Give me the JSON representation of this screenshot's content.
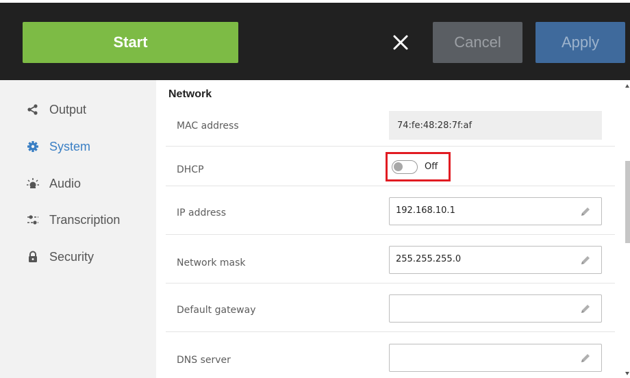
{
  "toolbar": {
    "start_label": "Start",
    "close_icon": "close-icon",
    "cancel_label": "Cancel",
    "apply_label": "Apply"
  },
  "sidebar": {
    "items": [
      {
        "label": "Output",
        "icon": "share-icon",
        "active": false
      },
      {
        "label": "System",
        "icon": "gear-icon",
        "active": true
      },
      {
        "label": "Audio",
        "icon": "audio-icon",
        "active": false
      },
      {
        "label": "Transcription",
        "icon": "sliders-icon",
        "active": false
      },
      {
        "label": "Security",
        "icon": "lock-icon",
        "active": false
      }
    ]
  },
  "network": {
    "title": "Network",
    "mac": {
      "label": "MAC address",
      "value": "74:fe:48:28:7f:af"
    },
    "dhcp": {
      "label": "DHCP",
      "state": "Off"
    },
    "ip": {
      "label": "IP address",
      "value": "192.168.10.1"
    },
    "mask": {
      "label": "Network mask",
      "value": "255.255.255.0"
    },
    "gateway": {
      "label": "Default gateway",
      "value": ""
    },
    "dns": {
      "label": "DNS server",
      "value": ""
    }
  },
  "colors": {
    "start": "#7dbb45",
    "cancel": "#5a5e63",
    "apply": "#3f6a9c",
    "active_nav": "#3a7fc4",
    "highlight": "#e11b22"
  }
}
